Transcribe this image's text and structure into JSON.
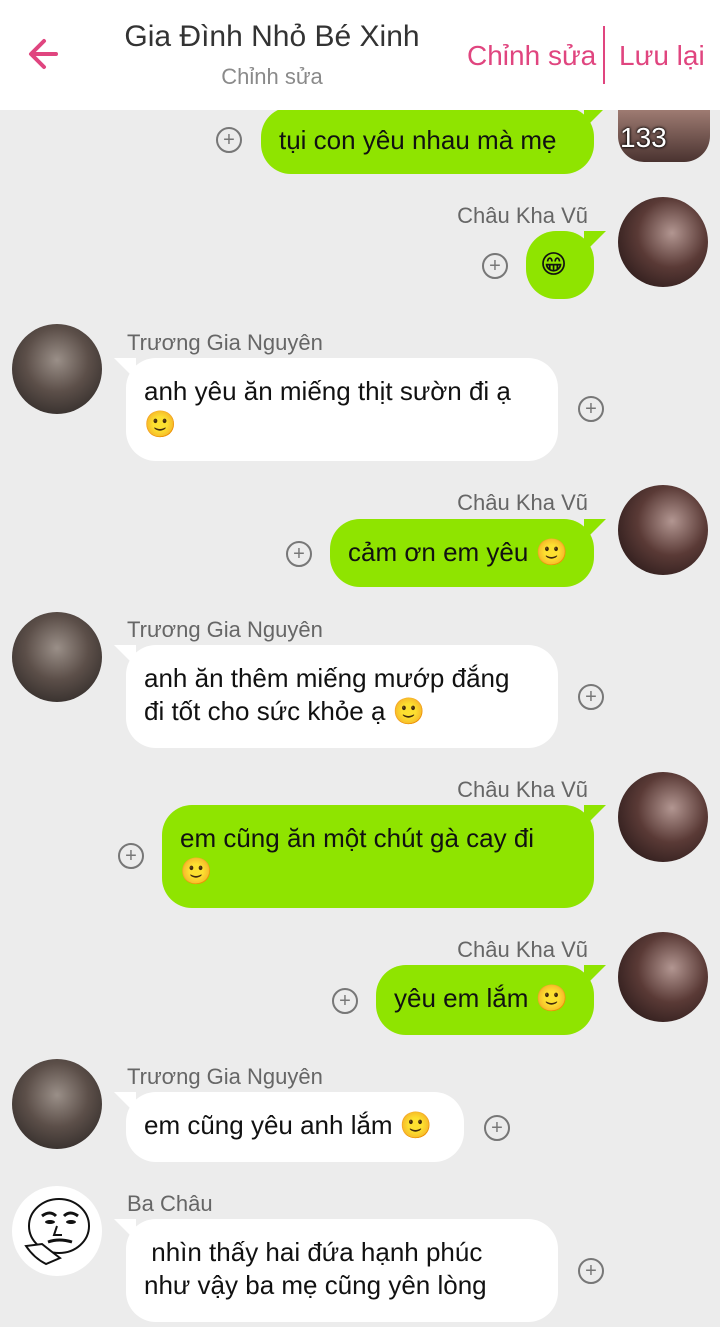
{
  "header": {
    "title": "Gia Đình Nhỏ Bé Xinh",
    "subtitle": "Chỉnh sửa",
    "edit_label": "Chỉnh sửa",
    "save_label": "Lưu lại",
    "accent_color": "#e0457f"
  },
  "colors": {
    "outgoing_bubble": "#8fe400",
    "incoming_bubble": "#ffffff",
    "background": "#ececec"
  },
  "top_avatar_overlay": "133 joy",
  "messages": [
    {
      "side": "out",
      "sender": "",
      "text": "tụi con yêu nhau mà mẹ"
    },
    {
      "side": "out",
      "sender": "Châu Kha Vũ",
      "text": "😁"
    },
    {
      "side": "in",
      "sender": "Trương Gia Nguyên",
      "text": "anh yêu ăn miếng thịt sườn đi ạ\n🙂"
    },
    {
      "side": "out",
      "sender": "Châu Kha Vũ",
      "text": "cảm ơn em yêu 🙂"
    },
    {
      "side": "in",
      "sender": "Trương Gia Nguyên",
      "text": "anh ăn thêm miếng mướp đắng\nđi tốt cho sức khỏe ạ 🙂"
    },
    {
      "side": "out",
      "sender": "Châu Kha Vũ",
      "text": "em cũng ăn một chút gà cay đi\n🙂"
    },
    {
      "side": "out",
      "sender": "Châu Kha Vũ",
      "text": "yêu em lắm 🙂"
    },
    {
      "side": "in",
      "sender": "Trương Gia Nguyên",
      "text": "em cũng yêu anh lắm 🙂"
    },
    {
      "side": "in",
      "sender": "Ba Châu",
      "text": " nhìn thấy hai đứa hạnh phúc\nnhư vậy ba mẹ cũng yên lòng"
    }
  ]
}
